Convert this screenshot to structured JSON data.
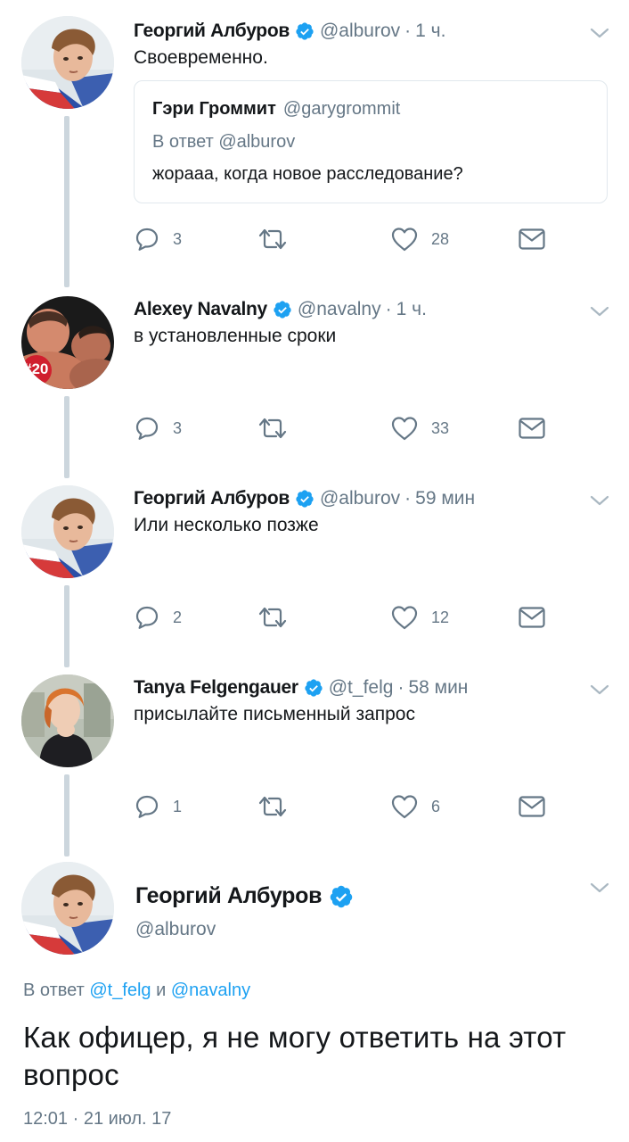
{
  "colors": {
    "accent": "#1da1f2",
    "secondary_text": "#657786",
    "thread_line": "#ccd6dd",
    "verified": "#1da1f2"
  },
  "icons": {
    "reply": "reply-icon",
    "retweet": "retweet-icon",
    "like": "heart-icon",
    "dm": "envelope-icon",
    "menu": "chevron-down-icon",
    "verified": "verified-badge-icon"
  },
  "tweets": [
    {
      "name": "Георгий Албуров",
      "handle": "@alburov",
      "dot": "·",
      "time": "1 ч.",
      "text": "Своевременно.",
      "quote": {
        "name": "Гэри Громмит",
        "handle": "@garygrommit",
        "reply_to": "В ответ @alburov",
        "text": "жорааа, когда новое расследование?"
      },
      "replies": "3",
      "retweets": "",
      "likes": "28"
    },
    {
      "name": "Alexey Navalny",
      "handle": "@navalny",
      "dot": "·",
      "time": "1 ч.",
      "text": "в установленные сроки",
      "avatar_badge": "#20",
      "replies": "3",
      "retweets": "",
      "likes": "33"
    },
    {
      "name": "Георгий Албуров",
      "handle": "@alburov",
      "dot": "·",
      "time": "59 мин",
      "text": "Или несколько позже",
      "replies": "2",
      "retweets": "",
      "likes": "12"
    },
    {
      "name": "Tanya Felgengauer",
      "handle": "@t_felg",
      "dot": "·",
      "time": "58 мин",
      "text": "присылайте письменный запрос",
      "replies": "1",
      "retweets": "",
      "likes": "6"
    }
  ],
  "main": {
    "name": "Георгий Албуров",
    "handle": "@alburov",
    "reply_prefix": "В ответ",
    "reply_user1": "@t_felg",
    "reply_and": "и",
    "reply_user2": "@navalny",
    "text": "Как офицер, я не могу ответить на этот вопрос",
    "timestamp": "12:01 · 21 июл. 17"
  }
}
